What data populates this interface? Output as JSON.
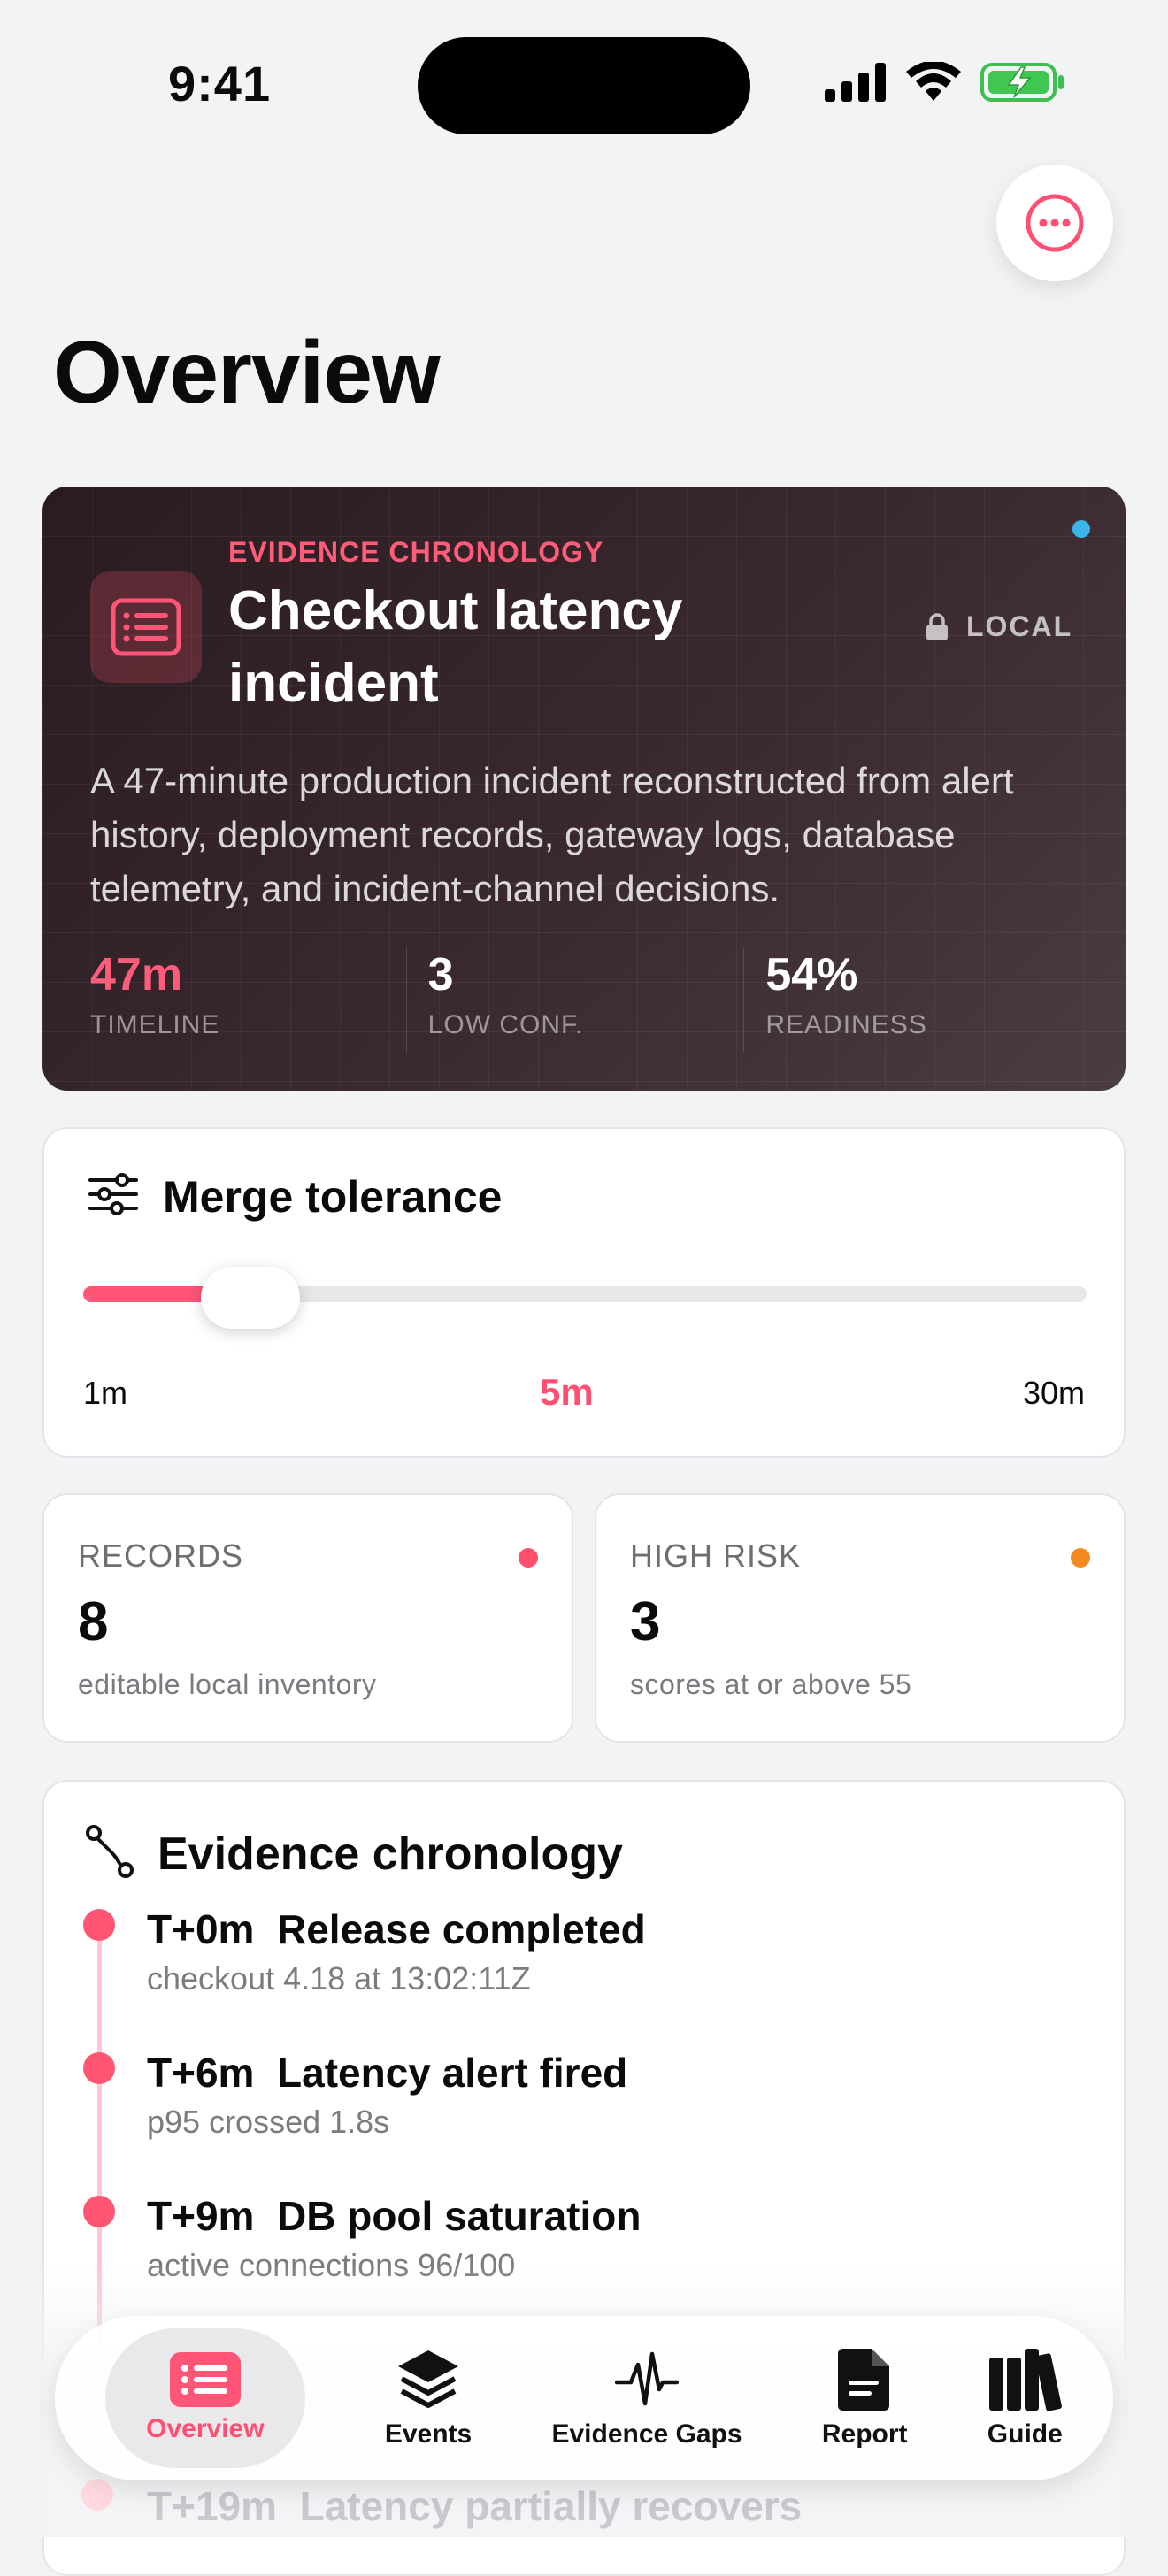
{
  "status_bar": {
    "time": "9:41"
  },
  "header": {
    "title": "Overview"
  },
  "hero": {
    "eyebrow": "EVIDENCE CHRONOLOGY",
    "title": "Checkout latency incident",
    "badge": "LOCAL",
    "description": "A 47-minute production incident reconstructed from alert history, deployment records, gateway logs, database telemetry, and incident-channel decisions.",
    "stats": [
      {
        "value": "47m",
        "label": "TIMELINE"
      },
      {
        "value": "3",
        "label": "LOW CONF."
      },
      {
        "value": "54%",
        "label": "READINESS"
      }
    ],
    "accent_color": "#ff5c7a"
  },
  "merge_tolerance": {
    "title": "Merge tolerance",
    "min_label": "1m",
    "max_label": "30m",
    "value_label": "5m",
    "position_fraction": 0.14
  },
  "metrics": {
    "records": {
      "label": "RECORDS",
      "value": "8",
      "sub": "editable local inventory",
      "dot_color": "#ff4f6d"
    },
    "high_risk": {
      "label": "HIGH RISK",
      "value": "3",
      "sub": "scores at or above 55",
      "dot_color": "#f58a22"
    }
  },
  "chronology": {
    "title": "Evidence chronology",
    "events": [
      {
        "head": "T+0m  Release completed",
        "sub": "checkout 4.18 at 13:02:11Z"
      },
      {
        "head": "T+6m  Latency alert fired",
        "sub": "p95 crossed 1.8s"
      },
      {
        "head": "T+9m  DB pool saturation",
        "sub": "active connections 96/100"
      }
    ],
    "partial_event": "T+19m  Latency partially recovers"
  },
  "tabbar": {
    "tabs": [
      {
        "label": "Overview",
        "icon": "list-icon",
        "active": true
      },
      {
        "label": "Events",
        "icon": "layers-icon"
      },
      {
        "label": "Evidence Gaps",
        "icon": "waveform-icon"
      },
      {
        "label": "Report",
        "icon": "document-icon"
      },
      {
        "label": "Guide",
        "icon": "books-icon"
      }
    ]
  }
}
